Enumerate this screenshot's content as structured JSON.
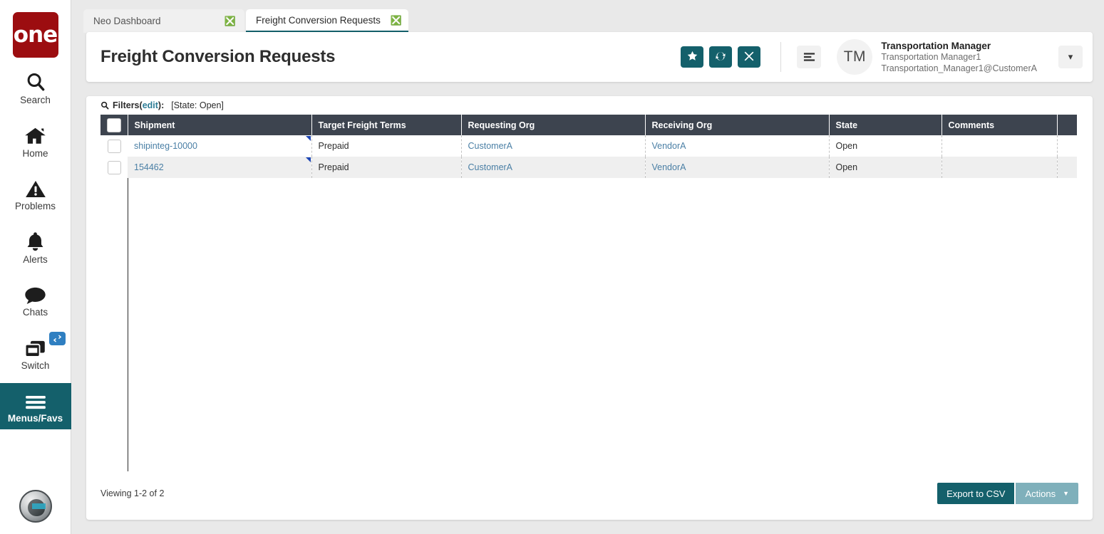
{
  "brand": {
    "logo_text": "one"
  },
  "sidebar": {
    "items": [
      {
        "label": "Search",
        "icon": "search-icon",
        "active": false
      },
      {
        "label": "Home",
        "icon": "home-icon",
        "active": false
      },
      {
        "label": "Problems",
        "icon": "warning-icon",
        "active": false
      },
      {
        "label": "Alerts",
        "icon": "bell-icon",
        "active": false
      },
      {
        "label": "Chats",
        "icon": "chat-icon",
        "active": false
      },
      {
        "label": "Switch",
        "icon": "windows-icon",
        "active": false,
        "badge_icon": "swap-arrows-icon"
      },
      {
        "label": "Menus/Favs",
        "icon": "hamburger-icon",
        "active": true
      }
    ],
    "agent_icon": "ai-assistant-orb-icon"
  },
  "tabs": [
    {
      "label": "Neo Dashboard",
      "active": false,
      "close_icon": "close-circle-icon"
    },
    {
      "label": "Freight Conversion Requests",
      "active": true,
      "close_icon": "close-circle-icon"
    }
  ],
  "header": {
    "title": "Freight Conversion Requests",
    "actions": [
      {
        "name": "favorite-button",
        "icon": "star-icon"
      },
      {
        "name": "refresh-button",
        "icon": "refresh-icon"
      },
      {
        "name": "close-button",
        "icon": "x-icon"
      }
    ],
    "menu_icon": "list-menu-icon",
    "user": {
      "initials": "TM",
      "role": "Transportation Manager",
      "username": "Transportation Manager1",
      "email": "Transportation_Manager1@CustomerA"
    },
    "caret_icon": "chevron-down-icon"
  },
  "filters": {
    "icon": "search-icon",
    "label": "Filters",
    "edit_label": "edit",
    "open_paren": "(",
    "close_paren": "):",
    "value": "[State: Open]"
  },
  "table": {
    "columns": [
      "Shipment",
      "Target Freight Terms",
      "Requesting Org",
      "Receiving Org",
      "State",
      "Comments"
    ],
    "rows": [
      {
        "shipment": "shipinteg-10000",
        "target_freight_terms": "Prepaid",
        "requesting_org": "CustomerA",
        "receiving_org": "VendorA",
        "state": "Open",
        "comments": ""
      },
      {
        "shipment": "154462",
        "target_freight_terms": "Prepaid",
        "requesting_org": "CustomerA",
        "receiving_org": "VendorA",
        "state": "Open",
        "comments": ""
      }
    ]
  },
  "footer": {
    "viewing": "Viewing 1-2 of 2",
    "export_label": "Export to CSV",
    "actions_label": "Actions",
    "actions_caret_icon": "caret-down-icon"
  },
  "colors": {
    "brand_red": "#9c0d10",
    "teal": "#14606b",
    "teal_light": "#7fb0bb",
    "header_dark": "#3d444f",
    "link_blue": "#4a7fa5",
    "edit_link": "#2e7d96",
    "corner_flag": "#1d46b4",
    "badge_blue": "#2f7fc1"
  }
}
